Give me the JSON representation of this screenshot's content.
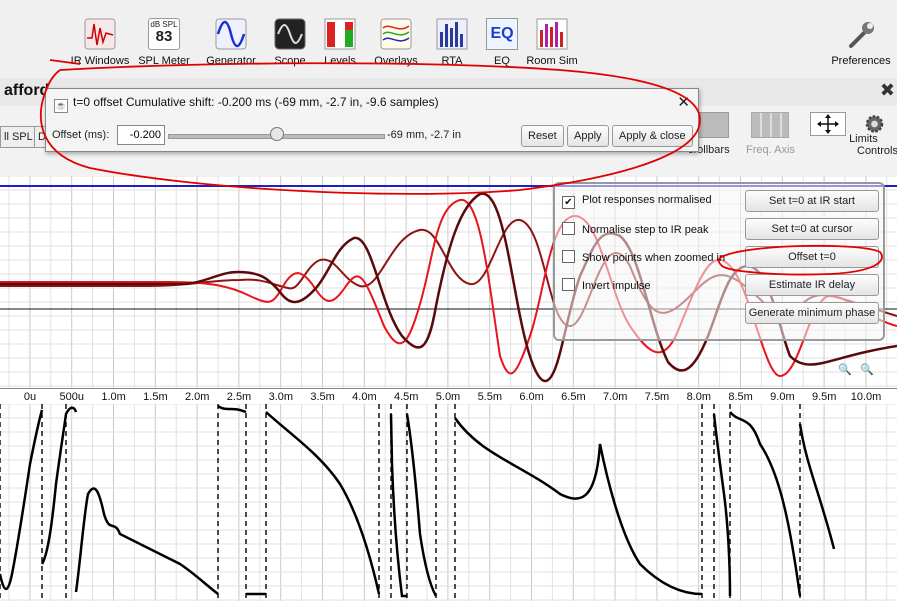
{
  "toolbar": {
    "items": [
      {
        "label": "IR Windows",
        "icon": "ir-windows-icon"
      },
      {
        "label": "SPL Meter",
        "icon": "spl-meter-icon",
        "badge_top": "dB SPL",
        "badge_value": "83"
      },
      {
        "label": "Generator",
        "icon": "generator-icon"
      },
      {
        "label": "Scope",
        "icon": "scope-icon"
      },
      {
        "label": "Levels",
        "icon": "levels-icon"
      },
      {
        "label": "Overlays",
        "icon": "overlays-icon"
      },
      {
        "label": "RTA",
        "icon": "rta-icon"
      },
      {
        "label": "EQ",
        "icon": "eq-icon",
        "text": "EQ"
      },
      {
        "label": "Room Sim",
        "icon": "room-sim-icon"
      }
    ],
    "preferences_label": "Preferences"
  },
  "window": {
    "title_partial": "afford",
    "close_glyph": "✖"
  },
  "left_buttons": {
    "all_spl": "ll SPL",
    "d": "D"
  },
  "right_tools": {
    "scrollbars": "crollbars",
    "freq_axis": "Freq. Axis",
    "limits": "Limits",
    "controls": "Controls"
  },
  "dialog": {
    "title": "t=0 offset  Cumulative shift: -0.200 ms (-69 mm, -2.7 in, -9.6 samples)",
    "close_glyph": "✕",
    "offset_label": "Offset (ms):",
    "offset_value": "-0.200",
    "offset_fraction": 0.5,
    "offset_readout": "-69 mm, -2.7 in",
    "buttons": {
      "reset": "Reset",
      "apply": "Apply",
      "apply_close": "Apply & close"
    }
  },
  "panel": {
    "checkboxes": [
      {
        "label": "Plot responses normalised",
        "checked": true
      },
      {
        "label": "Normalise step to IR peak",
        "checked": false
      },
      {
        "label": "Show points when zoomed in",
        "checked": false
      },
      {
        "label": "Invert impulse",
        "checked": false
      }
    ],
    "buttons": [
      "Set t=0 at IR start",
      "Set t=0 at cursor",
      "Offset t=0",
      "Estimate IR delay",
      "Generate minimum phase"
    ]
  },
  "x_axis": {
    "ticks": [
      "0u",
      "500u",
      "1.0m",
      "1.5m",
      "2.0m",
      "2.5m",
      "3.0m",
      "3.5m",
      "4.0m",
      "4.5m",
      "5.0m",
      "5.5m",
      "6.0m",
      "6.5m",
      "7.0m",
      "7.5m",
      "8.0m",
      "8.5m",
      "9.0m",
      "9.5m",
      "10.0m"
    ]
  },
  "colors": {
    "accent_blue": "#1f1fc8",
    "trace_red": "#e8141e",
    "trace_dark": "#5a0a0a",
    "trace_mid": "#8e1414",
    "annotation_red": "#e00000"
  },
  "check_glyph": "✔"
}
